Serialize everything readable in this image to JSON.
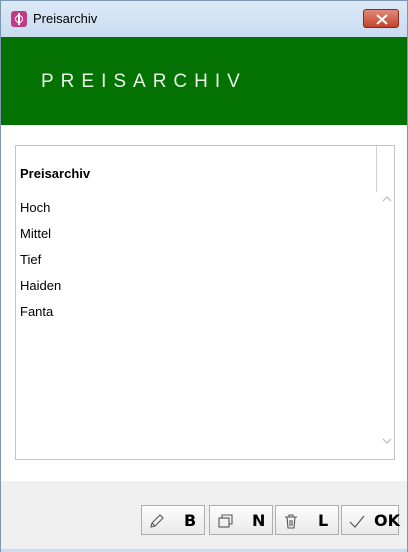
{
  "window": {
    "title": "Preisarchiv"
  },
  "banner": {
    "title": "PREISARCHIV"
  },
  "list": {
    "header": "Preisarchiv",
    "items": [
      "Hoch",
      "Mittel",
      "Tief",
      "Haiden",
      "Fanta"
    ]
  },
  "buttons": {
    "edit_label": "B",
    "new_label": "N",
    "delete_label": "L",
    "ok_label": "OK"
  },
  "icons": {
    "app": "app-logo-icon",
    "close": "close-icon",
    "edit": "pencil-icon",
    "new": "copy-icon",
    "delete": "trash-icon",
    "ok": "checkmark-icon",
    "scroll_up": "chevron-up-icon",
    "scroll_down": "chevron-down-icon"
  },
  "colors": {
    "banner": "#037203",
    "close_button": "#c2442c"
  }
}
